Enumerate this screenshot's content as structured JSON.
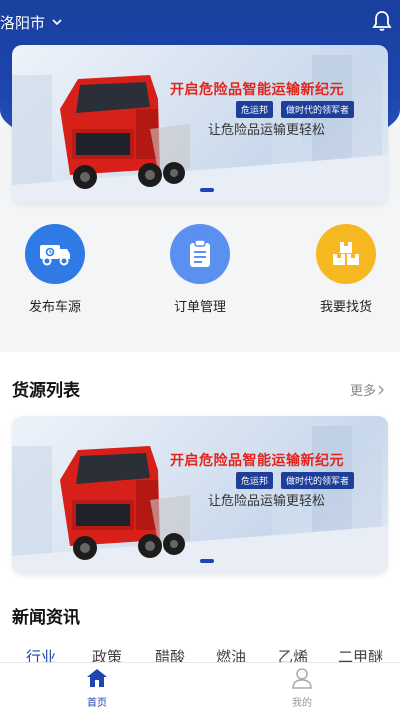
{
  "location": {
    "city": "洛阳市"
  },
  "banner": {
    "headline": "开启危险品智能运输新纪元",
    "tags": [
      "危运邦",
      "做时代的领军者"
    ],
    "subline": "让危险品运输更轻松"
  },
  "quick_actions": [
    {
      "label": "发布车源",
      "icon": "truck-icon",
      "color": "#2f7ae5"
    },
    {
      "label": "订单管理",
      "icon": "clipboard-icon",
      "color": "#5b8ff0"
    },
    {
      "label": "我要找货",
      "icon": "boxes-icon",
      "color": "#f5b820"
    }
  ],
  "goods_section": {
    "title": "货源列表",
    "more": "更多"
  },
  "news_section": {
    "title": "新闻资讯",
    "tabs": [
      "行业",
      "政策",
      "醋酸",
      "燃油",
      "乙烯",
      "二甲醚"
    ],
    "active_tab": "行业"
  },
  "bottom_nav": [
    {
      "label": "首页",
      "icon": "home-icon",
      "active": true
    },
    {
      "label": "我的",
      "icon": "user-icon",
      "active": false
    }
  ],
  "colors": {
    "primary": "#1d46b0",
    "headline_red": "#e3241b"
  }
}
